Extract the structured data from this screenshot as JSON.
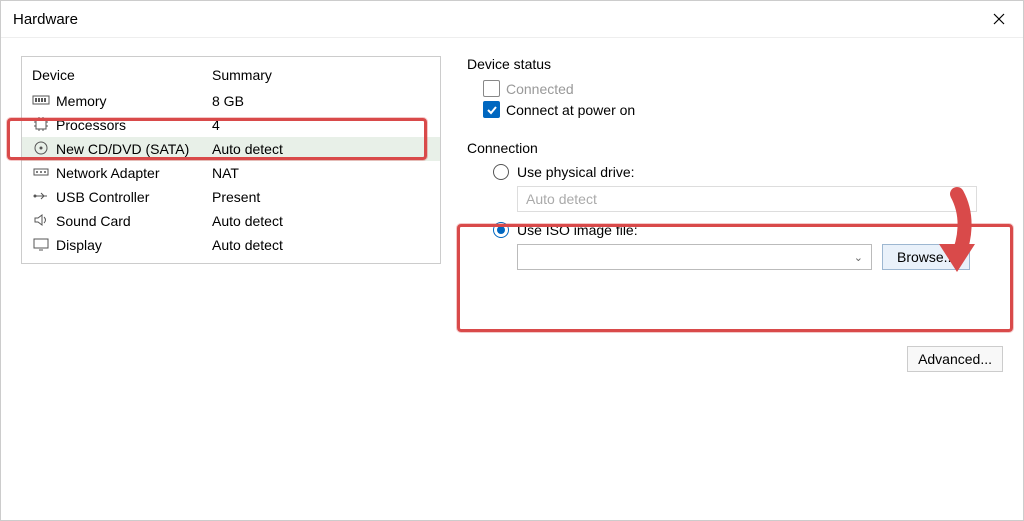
{
  "window": {
    "title": "Hardware"
  },
  "device_table": {
    "headers": {
      "device": "Device",
      "summary": "Summary"
    },
    "rows": [
      {
        "name": "Memory",
        "summary": "8 GB",
        "icon": "memory-icon"
      },
      {
        "name": "Processors",
        "summary": "4",
        "icon": "cpu-icon"
      },
      {
        "name": "New CD/DVD (SATA)",
        "summary": "Auto detect",
        "icon": "cdrom-icon",
        "selected": true
      },
      {
        "name": "Network Adapter",
        "summary": "NAT",
        "icon": "network-icon"
      },
      {
        "name": "USB Controller",
        "summary": "Present",
        "icon": "usb-icon"
      },
      {
        "name": "Sound Card",
        "summary": "Auto detect",
        "icon": "sound-icon"
      },
      {
        "name": "Display",
        "summary": "Auto detect",
        "icon": "display-icon"
      }
    ]
  },
  "device_status": {
    "label": "Device status",
    "connected": {
      "label": "Connected",
      "checked": false
    },
    "connect_power_on": {
      "label": "Connect at power on",
      "checked": true
    }
  },
  "connection": {
    "label": "Connection",
    "physical": {
      "label": "Use physical drive:",
      "selected": false,
      "value": "Auto detect"
    },
    "iso": {
      "label": "Use ISO image file:",
      "selected": true,
      "path": ""
    },
    "browse": "Browse..."
  },
  "advanced": "Advanced..."
}
